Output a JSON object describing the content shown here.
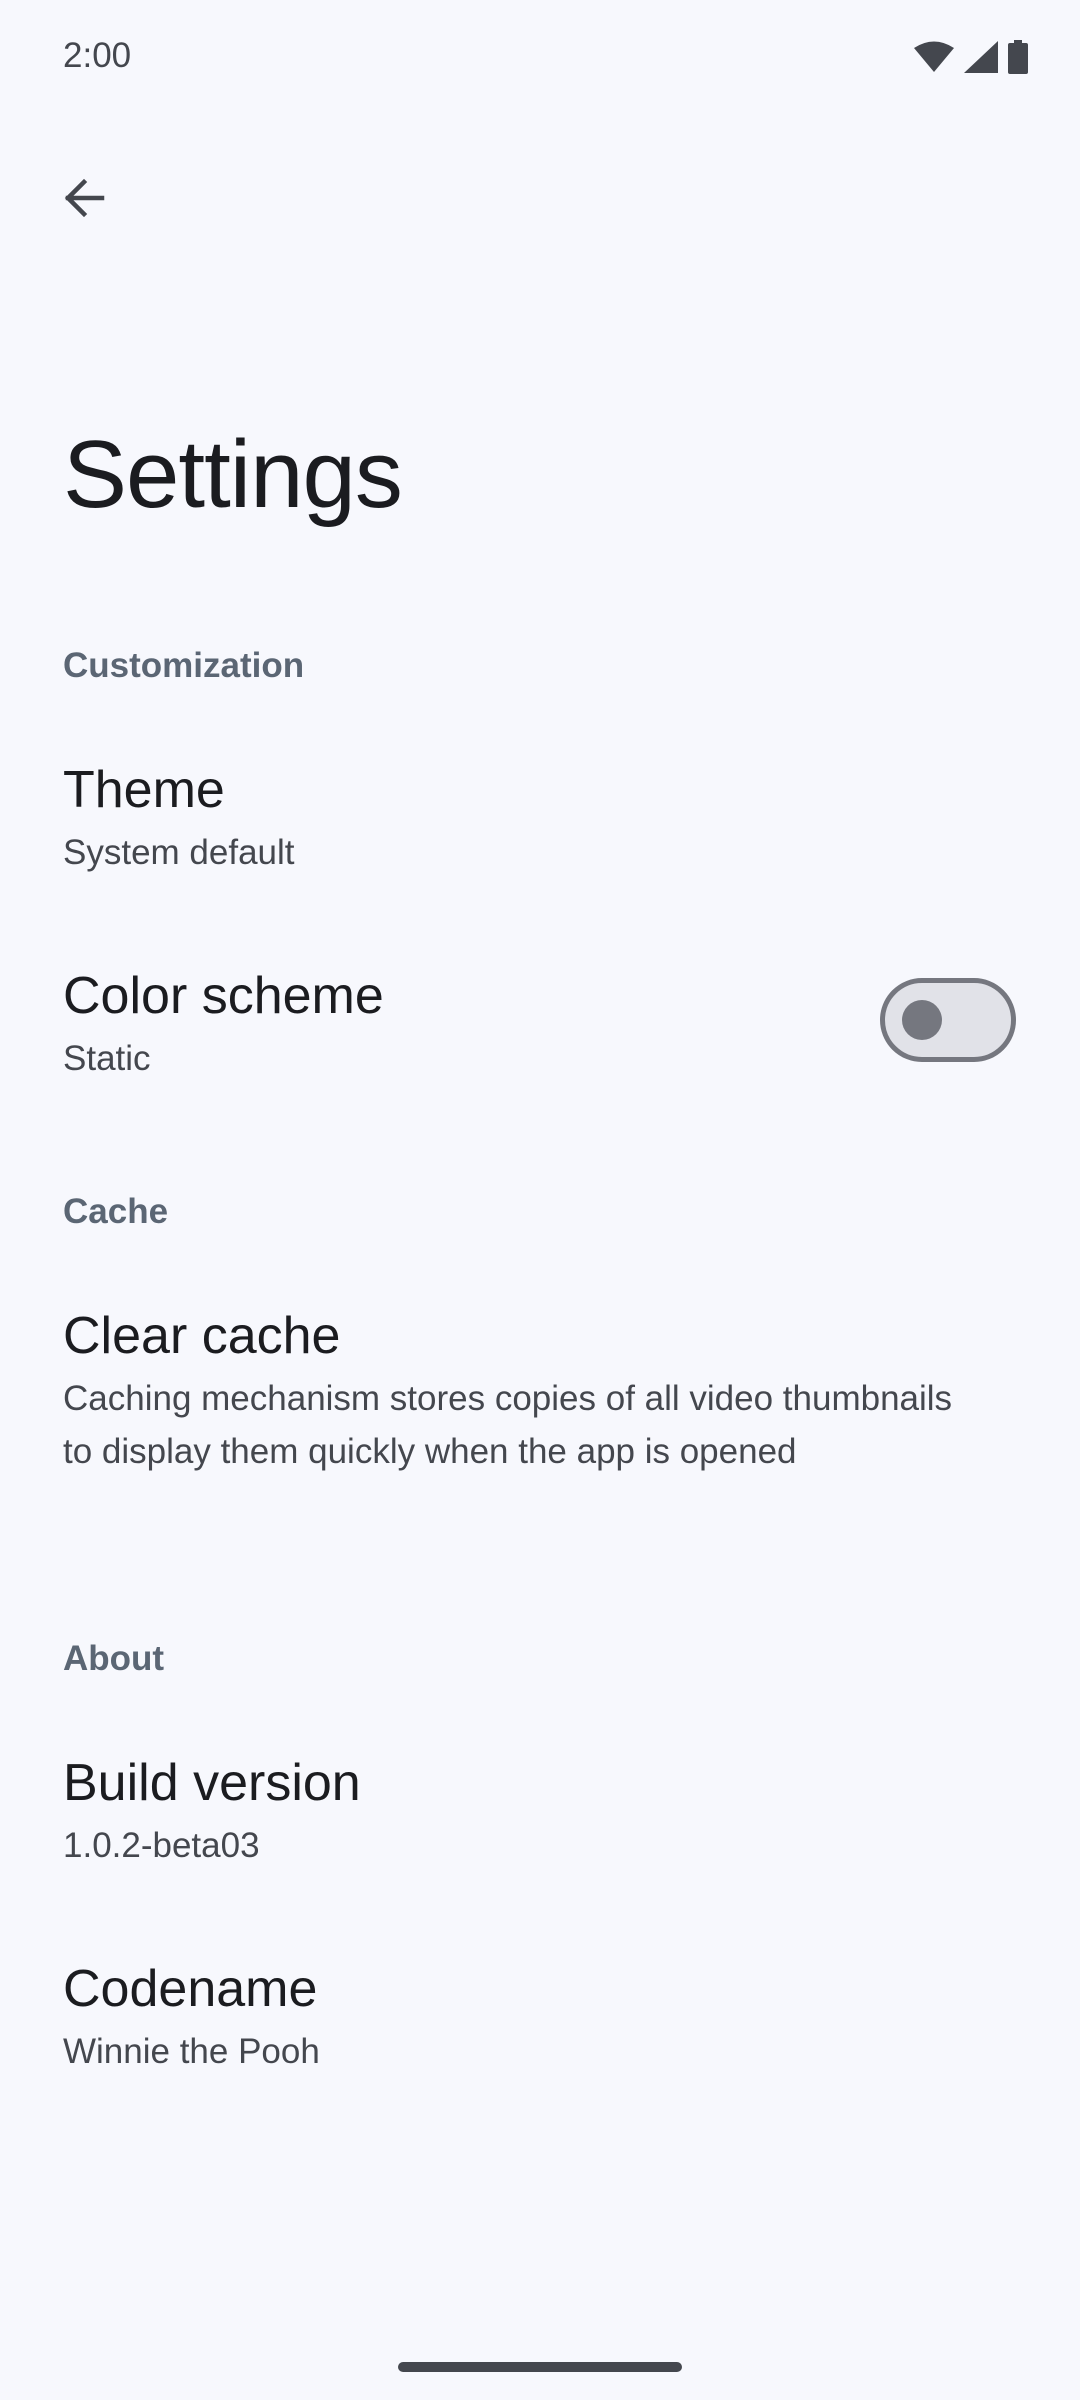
{
  "status_bar": {
    "time": "2:00",
    "icons": [
      "wifi-icon",
      "cellular-signal-icon",
      "battery-icon"
    ]
  },
  "app_bar": {
    "back_icon": "arrow-back-icon"
  },
  "page": {
    "title": "Settings"
  },
  "sections": {
    "customization": {
      "header": "Customization",
      "theme": {
        "title": "Theme",
        "summary": "System default"
      },
      "color_scheme": {
        "title": "Color scheme",
        "summary": "Static",
        "switch_on": false
      }
    },
    "cache": {
      "header": "Cache",
      "clear_cache": {
        "title": "Clear cache",
        "summary": "Caching mechanism stores copies of all video thumbnails to display them quickly when the app is opened"
      }
    },
    "about": {
      "header": "About",
      "build_version": {
        "title": "Build version",
        "summary": "1.0.2-beta03"
      },
      "codename": {
        "title": "Codename",
        "summary": "Winnie the Pooh"
      }
    }
  },
  "colors": {
    "background": "#f7f8fd",
    "section_header": "#5b6674",
    "text_primary": "#1b1c20",
    "text_secondary": "#44474e",
    "switch_off_outline": "#75777f"
  }
}
